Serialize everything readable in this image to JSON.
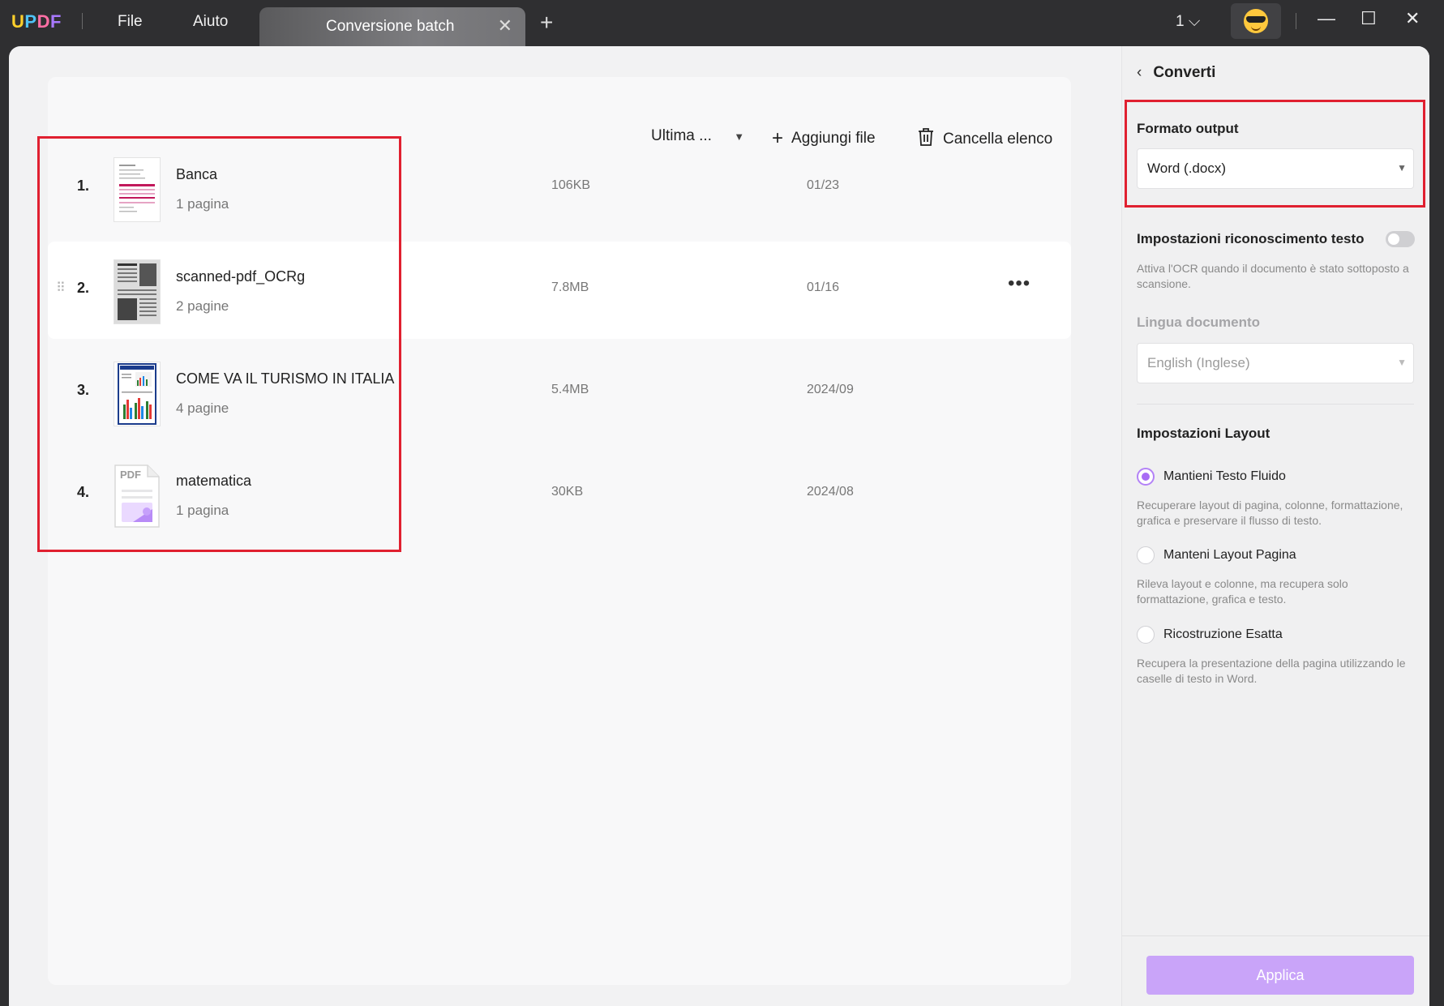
{
  "titlebar": {
    "logo": {
      "u": "U",
      "p": "P",
      "d": "D",
      "f": "F"
    },
    "menu": {
      "file": "File",
      "help": "Aiuto"
    },
    "tab": {
      "label": "Conversione batch",
      "close": "✕"
    },
    "add_tab": "+",
    "page_selector": "1 ⌵",
    "window_controls": {
      "minimize": "—",
      "maximize": "☐",
      "close": "✕"
    }
  },
  "toolbar": {
    "sort": "Ultima ...",
    "sort_caret": "▼",
    "add_files": "Aggiungi file",
    "add_icon": "+",
    "clear_list": "Cancella elenco"
  },
  "files": [
    {
      "index": "1.",
      "name": "Banca",
      "pages": "1 pagina",
      "size": "106KB",
      "date": "01/23",
      "thumb": "bank-doc"
    },
    {
      "index": "2.",
      "name": "scanned-pdf_OCRg",
      "pages": "2 pagine",
      "size": "7.8MB",
      "date": "01/16",
      "thumb": "scanned-doc",
      "more": "•••",
      "drag": "⠿"
    },
    {
      "index": "3.",
      "name": "COME VA IL TURISMO IN ITALIA",
      "pages": "4 pagine",
      "size": "5.4MB",
      "date": "2024/09",
      "thumb": "chart-doc"
    },
    {
      "index": "4.",
      "name": "matematica",
      "pages": "1 pagina",
      "size": "30KB",
      "date": "2024/08",
      "thumb": "pdf-generic",
      "thumb_label": "PDF"
    }
  ],
  "sidebar": {
    "back": "‹",
    "title": "Converti",
    "output_format_label": "Formato output",
    "output_format_value": "Word (.docx)",
    "caret": "▼",
    "ocr_label": "Impostazioni riconoscimento testo",
    "ocr_help": "Attiva l'OCR quando il documento è stato sottoposto a scansione.",
    "language_label": "Lingua documento",
    "language_value": "English (Inglese)",
    "layout_label": "Impostazioni Layout",
    "options": [
      {
        "label": "Mantieni Testo Fluido",
        "help": "Recuperare layout di pagina, colonne, formattazione, grafica e preservare il flusso di testo.",
        "checked": true
      },
      {
        "label": "Manteni Layout Pagina",
        "help": "Rileva layout e colonne, ma recupera solo formattazione, grafica e testo.",
        "checked": false
      },
      {
        "label": "Ricostruzione Esatta",
        "help": "Recupera la presentazione della pagina utilizzando le caselle di testo in Word.",
        "checked": false
      }
    ],
    "apply": "Applica"
  },
  "colors": {
    "accent": "#a86cf5",
    "highlight": "#e02030",
    "apply_button": "#c9a4f9"
  }
}
